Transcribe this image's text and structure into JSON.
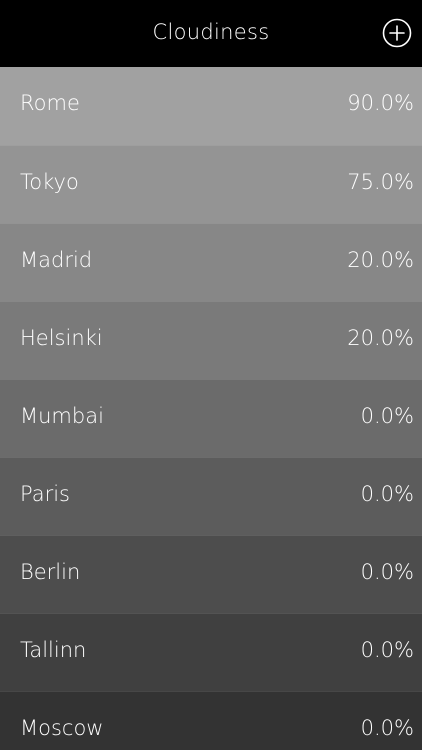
{
  "nav": {
    "title": "Cloudiness",
    "add_icon": "plus-circle-icon"
  },
  "colors": {
    "navbar": "#000000",
    "text": "#ffffff"
  },
  "rows": [
    {
      "city": "Rome",
      "value": "90.0%",
      "bg": "#a1a1a1"
    },
    {
      "city": "Tokyo",
      "value": "75.0%",
      "bg": "#949494"
    },
    {
      "city": "Madrid",
      "value": "20.0%",
      "bg": "#878787"
    },
    {
      "city": "Helsinki",
      "value": "20.0%",
      "bg": "#7a7a7a"
    },
    {
      "city": "Mumbai",
      "value": "0.0%",
      "bg": "#6b6b6b"
    },
    {
      "city": "Paris",
      "value": "0.0%",
      "bg": "#5c5c5c"
    },
    {
      "city": "Berlin",
      "value": "0.0%",
      "bg": "#4d4d4d"
    },
    {
      "city": "Tallinn",
      "value": "0.0%",
      "bg": "#404040"
    },
    {
      "city": "Moscow",
      "value": "0.0%",
      "bg": "#333333"
    }
  ]
}
